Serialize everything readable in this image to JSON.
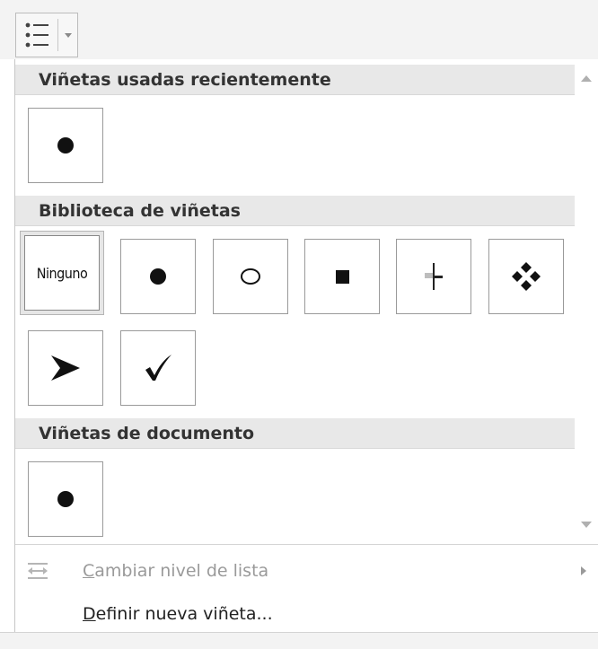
{
  "toolbar": {
    "bullets_button_icon": "bulleted-list-icon",
    "dropdown_arrow_icon": "chevron-down-icon"
  },
  "sections": {
    "recent": {
      "title": "Viñetas usadas recientemente"
    },
    "library": {
      "title": "Biblioteca de viñetas",
      "none_label": "Ninguno"
    },
    "document": {
      "title": "Viñetas de documento"
    }
  },
  "bullets": {
    "recent": [
      "filled-circle-bullet"
    ],
    "library": [
      "none",
      "filled-circle-bullet",
      "hollow-circle-bullet",
      "filled-square-bullet",
      "cross-bullet",
      "four-diamond-bullet",
      "arrowhead-bullet",
      "checkmark-bullet"
    ],
    "document": [
      "filled-circle-bullet"
    ]
  },
  "menu": {
    "change_level": {
      "mnemonic": "C",
      "rest": "ambiar nivel de lista",
      "icon": "indent-arrows-icon",
      "submenu_icon": "chevron-right-icon"
    },
    "define_new": {
      "mnemonic": "D",
      "rest": "efinir nueva viñeta..."
    }
  },
  "colors": {
    "header_bg": "#e8e8e8",
    "disabled_text": "#9a9a9a",
    "toolbar_bg": "#f3f3f3"
  }
}
